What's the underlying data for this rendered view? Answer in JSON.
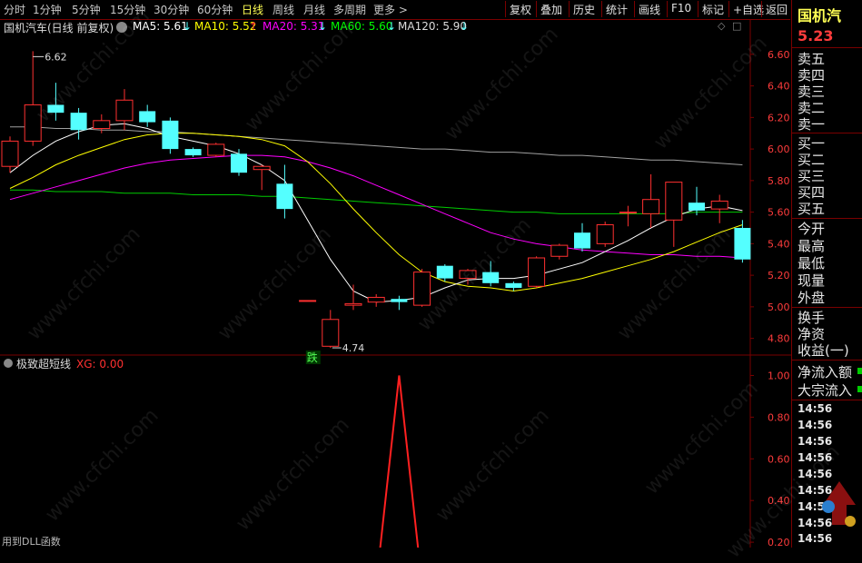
{
  "toolbar": {
    "periods": [
      "分时",
      "1分钟",
      "5分钟",
      "15分钟",
      "30分钟",
      "60分钟",
      "日线",
      "周线",
      "月线",
      "多周期",
      "更多"
    ],
    "active_period": "日线",
    "more_arrow": ">",
    "buttons": [
      "复权",
      "叠加",
      "历史",
      "统计",
      "画线",
      "F10",
      "标记",
      "+自选",
      "返回"
    ]
  },
  "main_header": {
    "stock_name": "国机汽车(日线 前复权)",
    "ma5": "MA5: 5.61",
    "ma10": "MA10: 5.52",
    "ma20": "MA20: 5.31",
    "ma60": "MA60: 5.60",
    "ma120": "MA120: 5.90",
    "arrow_down": "↓",
    "arrow_up": "↑"
  },
  "colors": {
    "ma5": "#ffffff",
    "ma10": "#ffff00",
    "ma20": "#ff00ff",
    "ma60": "#00cc00",
    "ma120": "#a0a0a0",
    "up_candle": "#ff3030",
    "down_candle": "#54ffff",
    "grid": "#7a0000",
    "axis_text": "#ff3c3c",
    "indicator": "#ff2020"
  },
  "price_axis": {
    "labels": [
      "6.60",
      "6.40",
      "6.20",
      "6.00",
      "5.80",
      "5.60",
      "5.40",
      "5.20",
      "5.00",
      "4.80"
    ],
    "values": [
      6.6,
      6.4,
      6.2,
      6.0,
      5.8,
      5.6,
      5.4,
      5.2,
      5.0,
      4.8
    ],
    "min": 4.7,
    "max": 6.72
  },
  "annotations": {
    "high_label": "6.62",
    "low_label": "4.74",
    "fall_badge": "跌"
  },
  "candles": [
    {
      "o": 5.89,
      "c": 6.05,
      "h": 6.08,
      "l": 5.85
    },
    {
      "o": 6.05,
      "c": 6.28,
      "h": 6.62,
      "l": 6.02
    },
    {
      "o": 6.28,
      "c": 6.23,
      "h": 6.42,
      "l": 6.18
    },
    {
      "o": 6.23,
      "c": 6.12,
      "h": 6.26,
      "l": 6.06
    },
    {
      "o": 6.13,
      "c": 6.18,
      "h": 6.22,
      "l": 6.1
    },
    {
      "o": 6.18,
      "c": 6.31,
      "h": 6.38,
      "l": 6.12
    },
    {
      "o": 6.24,
      "c": 6.17,
      "h": 6.28,
      "l": 6.14
    },
    {
      "o": 6.18,
      "c": 6.0,
      "h": 6.2,
      "l": 5.97
    },
    {
      "o": 6.0,
      "c": 5.96,
      "h": 6.01,
      "l": 5.95
    },
    {
      "o": 5.96,
      "c": 6.03,
      "h": 6.04,
      "l": 5.95
    },
    {
      "o": 5.97,
      "c": 5.85,
      "h": 6.0,
      "l": 5.83
    },
    {
      "o": 5.87,
      "c": 5.89,
      "h": 5.9,
      "l": 5.74
    },
    {
      "o": 5.78,
      "c": 5.62,
      "h": 5.9,
      "l": 5.56
    },
    {
      "o": 5.04,
      "c": 5.04,
      "h": 5.04,
      "l": 5.04
    },
    {
      "o": 4.75,
      "c": 4.92,
      "h": 4.98,
      "l": 4.74
    },
    {
      "o": 5.01,
      "c": 5.02,
      "h": 5.14,
      "l": 4.98
    },
    {
      "o": 5.03,
      "c": 5.06,
      "h": 5.08,
      "l": 5.0
    },
    {
      "o": 5.05,
      "c": 5.03,
      "h": 5.07,
      "l": 4.98
    },
    {
      "o": 5.01,
      "c": 5.22,
      "h": 5.24,
      "l": 5.0
    },
    {
      "o": 5.26,
      "c": 5.18,
      "h": 5.27,
      "l": 5.16
    },
    {
      "o": 5.18,
      "c": 5.23,
      "h": 5.24,
      "l": 5.14
    },
    {
      "o": 5.22,
      "c": 5.15,
      "h": 5.29,
      "l": 5.13
    },
    {
      "o": 5.15,
      "c": 5.12,
      "h": 5.16,
      "l": 5.1
    },
    {
      "o": 5.13,
      "c": 5.31,
      "h": 5.32,
      "l": 5.12
    },
    {
      "o": 5.32,
      "c": 5.39,
      "h": 5.4,
      "l": 5.3
    },
    {
      "o": 5.47,
      "c": 5.37,
      "h": 5.53,
      "l": 5.35
    },
    {
      "o": 5.4,
      "c": 5.52,
      "h": 5.54,
      "l": 5.38
    },
    {
      "o": 5.6,
      "c": 5.6,
      "h": 5.64,
      "l": 5.51
    },
    {
      "o": 5.59,
      "c": 5.68,
      "h": 5.84,
      "l": 5.5
    },
    {
      "o": 5.55,
      "c": 5.79,
      "h": 5.79,
      "l": 5.38
    },
    {
      "o": 5.66,
      "c": 5.61,
      "h": 5.76,
      "l": 5.58
    },
    {
      "o": 5.62,
      "c": 5.67,
      "h": 5.71,
      "l": 5.53
    },
    {
      "o": 5.5,
      "c": 5.3,
      "h": 5.55,
      "l": 5.28
    }
  ],
  "ma_lines": {
    "ma5": [
      5.85,
      5.96,
      6.05,
      6.11,
      6.15,
      6.16,
      6.13,
      6.08,
      6.05,
      6.02,
      5.97,
      5.9,
      5.8,
      5.55,
      5.3,
      5.1,
      5.03,
      5.04,
      5.06,
      5.12,
      5.17,
      5.18,
      5.18,
      5.2,
      5.24,
      5.28,
      5.35,
      5.42,
      5.5,
      5.57,
      5.62,
      5.64,
      5.61
    ],
    "ma10": [
      5.75,
      5.82,
      5.9,
      5.96,
      6.01,
      6.06,
      6.09,
      6.1,
      6.1,
      6.09,
      6.08,
      6.06,
      6.02,
      5.92,
      5.78,
      5.62,
      5.47,
      5.33,
      5.22,
      5.16,
      5.13,
      5.12,
      5.1,
      5.12,
      5.15,
      5.18,
      5.22,
      5.26,
      5.3,
      5.35,
      5.41,
      5.47,
      5.52
    ],
    "ma20": [
      5.68,
      5.72,
      5.76,
      5.8,
      5.84,
      5.88,
      5.91,
      5.93,
      5.94,
      5.95,
      5.96,
      5.96,
      5.95,
      5.92,
      5.88,
      5.83,
      5.77,
      5.71,
      5.65,
      5.59,
      5.53,
      5.47,
      5.43,
      5.4,
      5.38,
      5.36,
      5.35,
      5.34,
      5.33,
      5.33,
      5.32,
      5.32,
      5.31
    ],
    "ma60": [
      5.74,
      5.74,
      5.73,
      5.73,
      5.73,
      5.72,
      5.72,
      5.72,
      5.71,
      5.71,
      5.71,
      5.7,
      5.7,
      5.69,
      5.68,
      5.67,
      5.66,
      5.65,
      5.64,
      5.63,
      5.62,
      5.61,
      5.6,
      5.6,
      5.59,
      5.59,
      5.59,
      5.59,
      5.59,
      5.59,
      5.6,
      5.6,
      5.6
    ],
    "ma120": [
      6.14,
      6.14,
      6.13,
      6.13,
      6.12,
      6.12,
      6.11,
      6.11,
      6.1,
      6.09,
      6.08,
      6.07,
      6.06,
      6.05,
      6.04,
      6.03,
      6.02,
      6.01,
      6.0,
      6.0,
      5.99,
      5.98,
      5.98,
      5.97,
      5.96,
      5.96,
      5.95,
      5.94,
      5.93,
      5.93,
      5.92,
      5.91,
      5.9
    ]
  },
  "indicator": {
    "title": "极致超短线",
    "xg_label": "XG: 0.00",
    "axis_labels": [
      "1.00",
      "0.80",
      "0.60",
      "0.40",
      "0.20"
    ],
    "axis_values": [
      1.0,
      0.8,
      0.6,
      0.4,
      0.2
    ],
    "min": 0.0,
    "max": 1.05,
    "values": [
      0,
      0,
      0,
      0,
      0,
      0,
      0,
      0,
      0,
      0,
      0,
      0,
      0,
      0,
      0,
      0,
      0,
      1,
      0,
      0,
      0,
      0,
      0,
      0,
      0,
      0,
      0,
      0,
      0,
      0,
      0,
      0,
      0
    ],
    "footer": "用到DLL函数"
  },
  "right_panel": {
    "stock_name": "国机汽",
    "price": "5.23",
    "order_rows": [
      "卖五",
      "卖四",
      "卖三",
      "卖二",
      "卖一",
      "买一",
      "买二",
      "买三",
      "买四",
      "买五"
    ],
    "info_rows": [
      "今开",
      "最高",
      "最低",
      "现量",
      "外盘"
    ],
    "extra_rows": [
      "换手",
      "净资",
      "收益(一)"
    ],
    "flow_rows": [
      "净流入额",
      "大宗流入"
    ],
    "times": [
      "14:56",
      "14:56",
      "14:56",
      "14:56",
      "14:56",
      "14:56",
      "14:56",
      "14:56",
      "14:56"
    ]
  },
  "watermark": "www.cfchi.com"
}
